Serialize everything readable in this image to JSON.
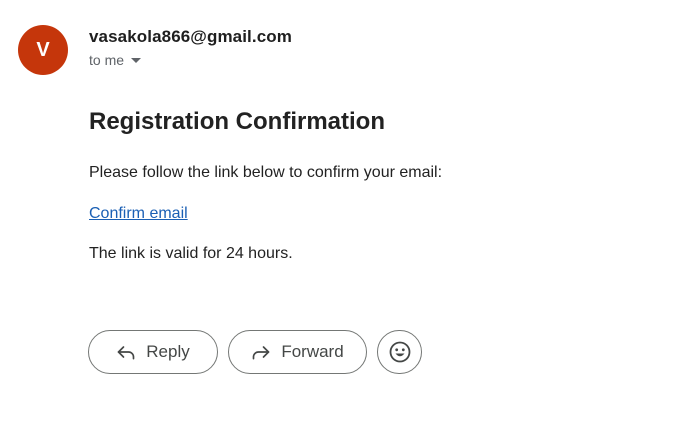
{
  "email": {
    "sender_initial": "V",
    "sender": "vasakola866@gmail.com",
    "recipient_label": "to me",
    "avatar_color": "#c5360b"
  },
  "body": {
    "heading": "Registration Confirmation",
    "paragraph_1": "Please follow the link below to confirm your email:",
    "link_text": "Confirm email",
    "paragraph_2": "The link is valid for 24 hours.",
    "link_color": "#1a5fb4"
  },
  "actions": {
    "reply_label": "Reply",
    "forward_label": "Forward",
    "reply_icon": "reply-arrow-icon",
    "forward_icon": "forward-arrow-icon",
    "emoji_icon": "emoji-reaction-icon"
  }
}
